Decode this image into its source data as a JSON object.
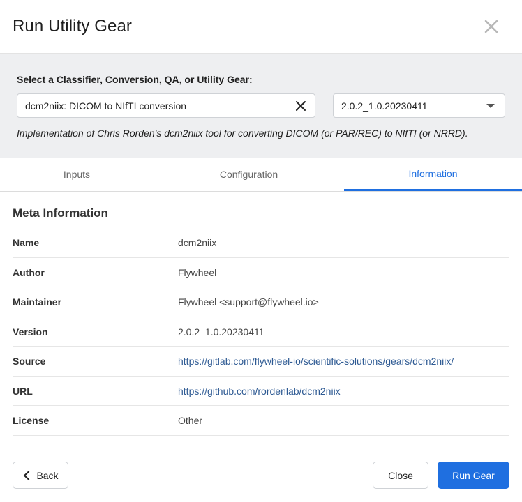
{
  "dialog": {
    "title": "Run Utility Gear"
  },
  "selector": {
    "label": "Select a Classifier, Conversion, QA, or Utility Gear:",
    "gear_value": "dcm2niix: DICOM to NIfTI conversion",
    "version_value": "2.0.2_1.0.20230411",
    "description": "Implementation of Chris Rorden's dcm2niix tool for converting DICOM (or PAR/REC) to NIfTI (or NRRD)."
  },
  "tabs": [
    {
      "label": "Inputs"
    },
    {
      "label": "Configuration"
    },
    {
      "label": "Information"
    }
  ],
  "meta": {
    "title": "Meta Information",
    "rows": [
      {
        "key": "Name",
        "value": "dcm2niix"
      },
      {
        "key": "Author",
        "value": "Flywheel"
      },
      {
        "key": "Maintainer",
        "value": "Flywheel <support@flywheel.io>"
      },
      {
        "key": "Version",
        "value": "2.0.2_1.0.20230411"
      },
      {
        "key": "Source",
        "value": "https://gitlab.com/flywheel-io/scientific-solutions/gears/dcm2niix/"
      },
      {
        "key": "URL",
        "value": "https://github.com/rordenlab/dcm2niix"
      },
      {
        "key": "License",
        "value": "Other"
      }
    ]
  },
  "footer": {
    "back_label": "Back",
    "close_label": "Close",
    "run_label": "Run Gear"
  },
  "colors": {
    "accent": "#1f6fe0",
    "link": "#2e5a93",
    "panel_bg": "#eeeff1"
  }
}
